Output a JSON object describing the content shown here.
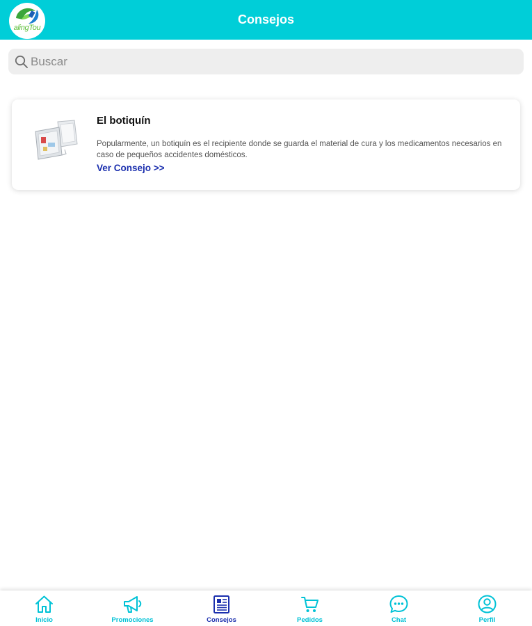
{
  "header": {
    "title": "Consejos",
    "logo_text": "alingTou",
    "logo_icon": "pharmacy-logo"
  },
  "search": {
    "placeholder": "Buscar",
    "value": "",
    "icon": "search-icon"
  },
  "tips": [
    {
      "title": "El botiquín",
      "description": "Popularmente, un botiquín es el recipiente donde se guarda el material de cura y los medicamentos necesarios en caso de pequeños accidentes domésticos.",
      "link": "Ver Consejo >>",
      "image_icon": "first-aid-kit-icon"
    }
  ],
  "tabbar": {
    "active": "Consejos",
    "accent_color": "#00c2d6",
    "active_color": "#1b2fae",
    "tabs": [
      {
        "label": "Inicio",
        "icon": "home-icon"
      },
      {
        "label": "Promociones",
        "icon": "megaphone-icon"
      },
      {
        "label": "Consejos",
        "icon": "newspaper-icon"
      },
      {
        "label": "Pedidos",
        "icon": "cart-icon"
      },
      {
        "label": "Chat",
        "icon": "chat-icon"
      },
      {
        "label": "Perfil",
        "icon": "profile-icon"
      }
    ]
  },
  "colors": {
    "header_bg": "#00ced8",
    "search_bg": "#eeeeee"
  }
}
